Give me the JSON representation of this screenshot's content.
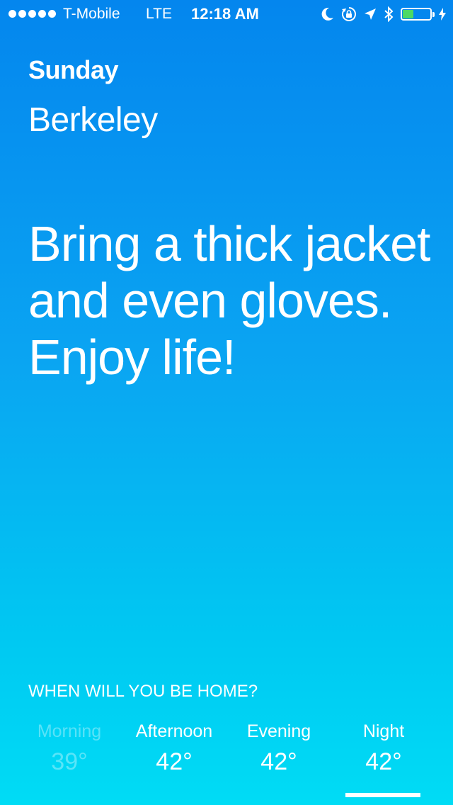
{
  "status_bar": {
    "carrier": "T-Mobile",
    "network": "LTE",
    "time": "12:18 AM",
    "signal_bars": 5,
    "battery_level": 0.4,
    "battery_color": "#4cd964",
    "icons": [
      "moon-icon",
      "rotation-lock-icon",
      "location-arrow-icon",
      "bluetooth-icon",
      "battery-icon",
      "charging-bolt-icon"
    ]
  },
  "header": {
    "day": "Sunday",
    "city": "Berkeley"
  },
  "message": "Bring a thick jacket and even gloves. Enjoy life!",
  "home": {
    "question": "WHEN WILL YOU BE HOME?",
    "periods": [
      {
        "name": "Morning",
        "temp": "39°",
        "state": "dimmed"
      },
      {
        "name": "Afternoon",
        "temp": "42°",
        "state": "normal"
      },
      {
        "name": "Evening",
        "temp": "42°",
        "state": "normal"
      },
      {
        "name": "Night",
        "temp": "42°",
        "state": "selected"
      }
    ]
  },
  "colors": {
    "gradient_top": "#0486ee",
    "gradient_bottom": "#00dcf5",
    "text": "#ffffff"
  }
}
